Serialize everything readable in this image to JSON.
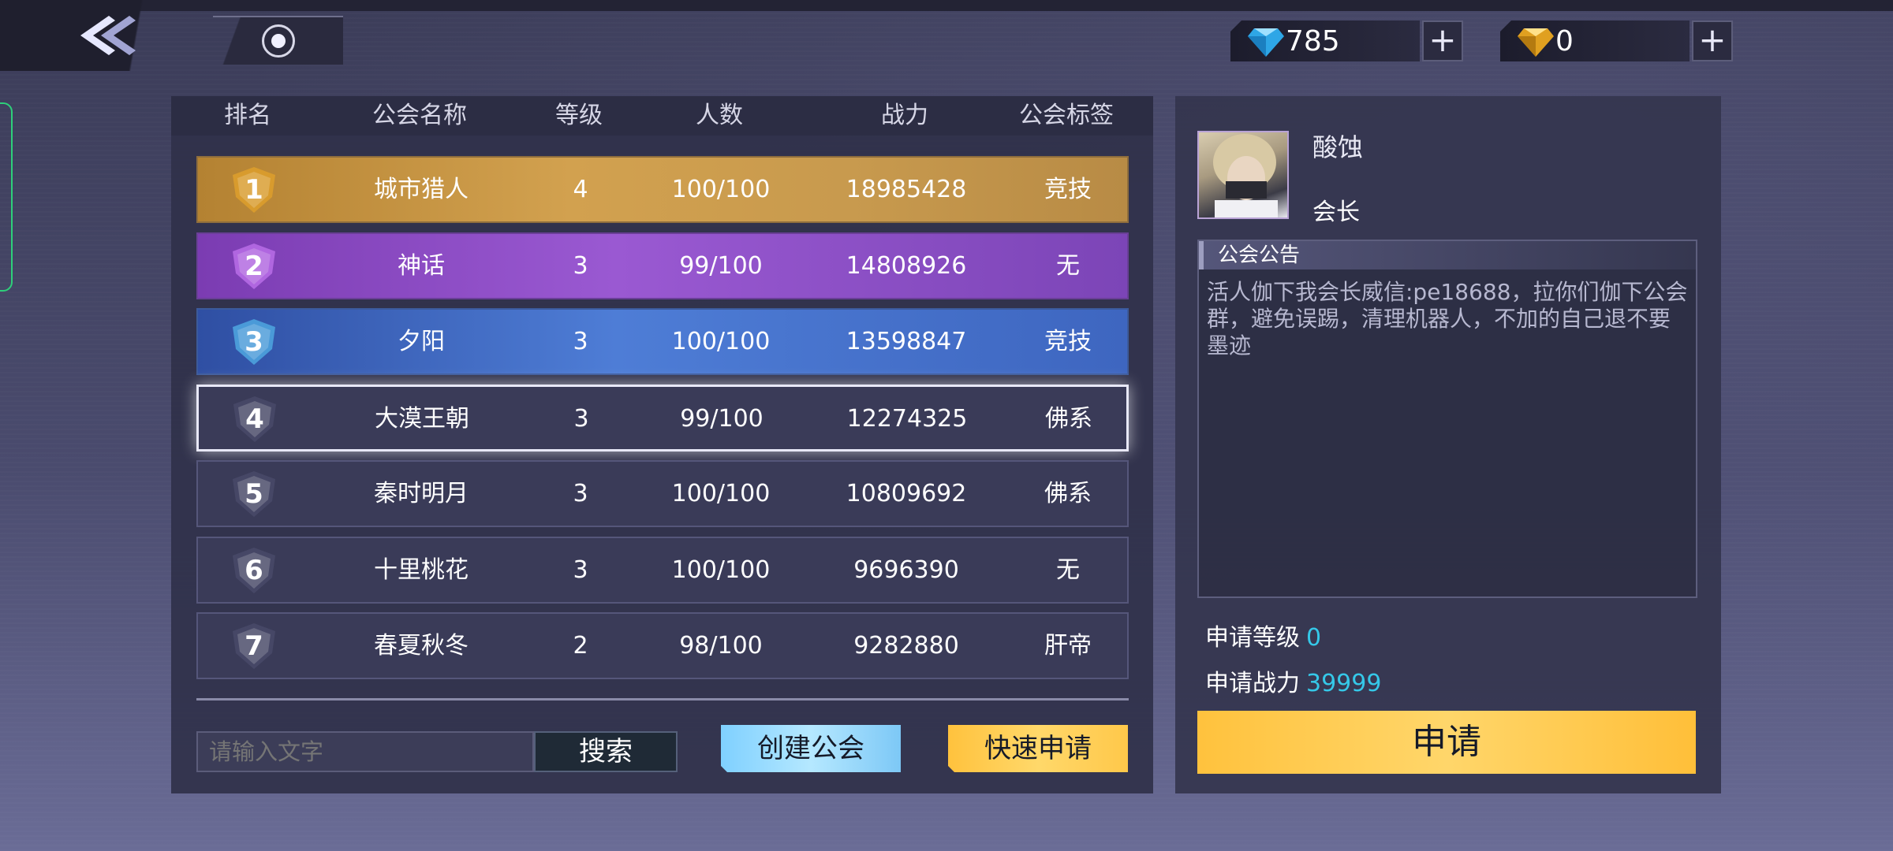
{
  "currencies": [
    {
      "name": "diamond",
      "amount": "785",
      "plus": "+",
      "color": "#39b8f0"
    },
    {
      "name": "gold-gem",
      "amount": "0",
      "plus": "+",
      "color": "#f0b429"
    }
  ],
  "table": {
    "columns": [
      "排名",
      "公会名称",
      "等级",
      "人数",
      "战力",
      "公会标签"
    ],
    "rows": [
      {
        "rank": "1",
        "name": "城市猎人",
        "level": "4",
        "members": "100/100",
        "power": "18985428",
        "tag": "竞技"
      },
      {
        "rank": "2",
        "name": "神话",
        "level": "3",
        "members": "99/100",
        "power": "14808926",
        "tag": "无"
      },
      {
        "rank": "3",
        "name": "夕阳",
        "level": "3",
        "members": "100/100",
        "power": "13598847",
        "tag": "竞技"
      },
      {
        "rank": "4",
        "name": "大漠王朝",
        "level": "3",
        "members": "99/100",
        "power": "12274325",
        "tag": "佛系"
      },
      {
        "rank": "5",
        "name": "秦时明月",
        "level": "3",
        "members": "100/100",
        "power": "10809692",
        "tag": "佛系"
      },
      {
        "rank": "6",
        "name": "十里桃花",
        "level": "3",
        "members": "100/100",
        "power": "9696390",
        "tag": "无"
      },
      {
        "rank": "7",
        "name": "春夏秋冬",
        "level": "2",
        "members": "98/100",
        "power": "9282880",
        "tag": "肝帝"
      }
    ]
  },
  "search": {
    "placeholder": "请输入文字",
    "button": "搜索"
  },
  "actions": {
    "create": "创建公会",
    "quick_apply": "快速申请"
  },
  "detail": {
    "leader_name": "酸蚀",
    "leader_title": "会长",
    "notice_title": "公会公告",
    "notice_text": "活人伽下我会长威信:pe18688，拉你们伽下公会群，避免误踢，清理机器人，不加的自己退不要墨迹",
    "req_level_label": "申请等级",
    "req_level_value": "0",
    "req_power_label": "申请战力",
    "req_power_value": "39999",
    "apply_button": "申请"
  }
}
